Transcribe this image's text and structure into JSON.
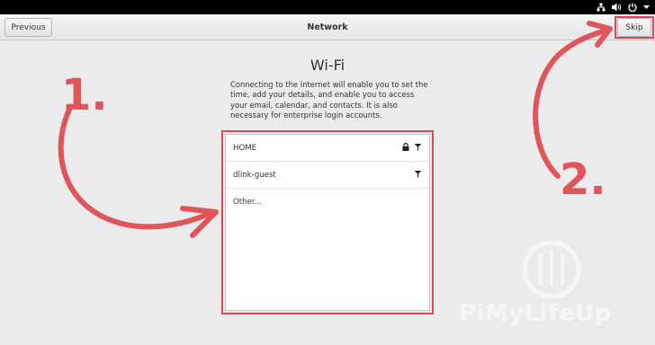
{
  "header": {
    "title": "Network",
    "previous_label": "Previous",
    "skip_label": "Skip"
  },
  "system_tray": {
    "icons": [
      "network-wired-icon",
      "volume-icon",
      "power-icon",
      "menu-arrow-icon"
    ]
  },
  "main": {
    "heading": "Wi-Fi",
    "description": "Connecting to the Internet will enable you to set the time, add your details, and enable you to access your email, calendar, and contacts. It is also necessary for enterprise login accounts."
  },
  "networks": [
    {
      "name": "HOME",
      "secured": true,
      "icon": "wifi-signal-icon"
    },
    {
      "name": "dlink-guest",
      "secured": false,
      "icon": "wifi-signal-icon"
    },
    {
      "name": "Other..."
    }
  ],
  "annotations": {
    "step1": "1.",
    "step2": "2.",
    "accent_color": "#e0555a"
  },
  "watermark": {
    "text": "PiMyLifeUp"
  }
}
